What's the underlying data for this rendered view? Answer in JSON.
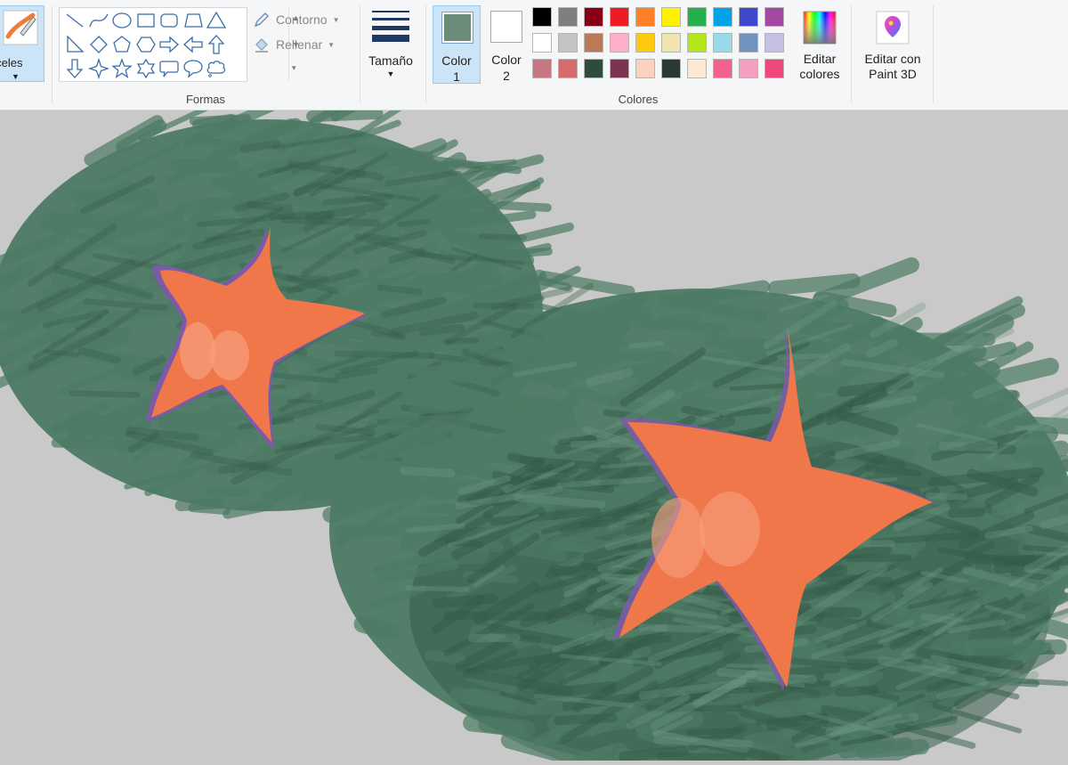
{
  "ribbon": {
    "brushes": {
      "label": "inceles"
    },
    "shapes": {
      "group_label": "Formas",
      "outline_label": "Contorno",
      "fill_label": "Rellenar",
      "gallery": [
        "line",
        "curve",
        "oval",
        "rectangle",
        "rounded-rectangle",
        "polygon",
        "triangle",
        "right-triangle",
        "diamond",
        "pentagon",
        "hexagon",
        "right-arrow",
        "left-arrow",
        "up-arrow",
        "down-arrow",
        "four-point-star",
        "five-point-star",
        "six-point-star",
        "rounded-callout",
        "oval-callout",
        "cloud-callout"
      ]
    },
    "size": {
      "label": "Tamaño"
    },
    "colors": {
      "group_label": "Colores",
      "color1_label": "Color\n1",
      "color1_value": "#6b8c79",
      "color2_label": "Color\n2",
      "color2_value": "#ffffff",
      "palette": [
        [
          "#000000",
          "#7f7f7f",
          "#880015",
          "#ed1c24",
          "#ff7f27",
          "#fff200",
          "#22b14c",
          "#00a2e8",
          "#3f48cc",
          "#a349a4"
        ],
        [
          "#ffffff",
          "#c3c3c3",
          "#b97a57",
          "#ffaec9",
          "#ffc90e",
          "#efe4b0",
          "#b5e61d",
          "#99d9ea",
          "#7092be",
          "#c8bfe7"
        ],
        [
          "#c77682",
          "#d66a6e",
          "#2f4b3c",
          "#7a3350",
          "#fbd2bf",
          "#2a3a31",
          "#fde8d3",
          "#f3628e",
          "#f49fbf",
          "#f0477d"
        ]
      ],
      "edit_colors_label": "Editar colores"
    },
    "paint3d": {
      "label": "Editar con Paint 3D"
    }
  },
  "canvas": {
    "background": "#c9c9c9",
    "scribble_color": "#4d7a64",
    "scribble_dark": "#355c4a",
    "star_color": "#f0774a",
    "star_highlight": "#f7a07f",
    "star_shadow": "#7d5aa8"
  }
}
